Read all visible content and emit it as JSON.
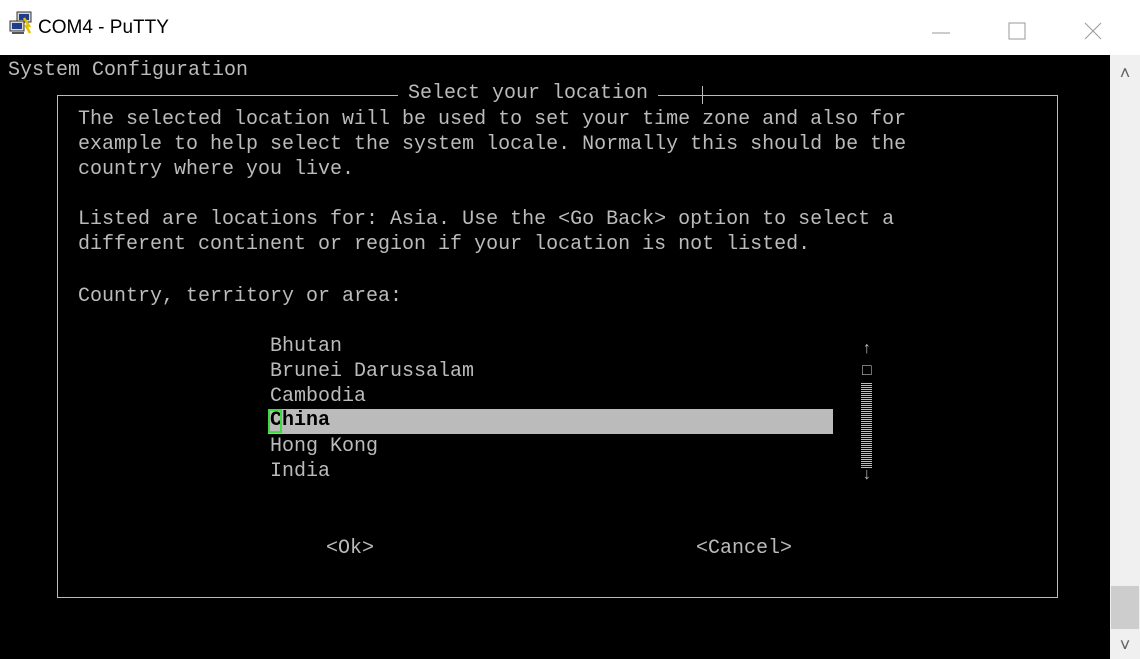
{
  "window": {
    "title": "COM4 - PuTTY",
    "icons": [
      "putty-icon",
      "minimize-icon",
      "maximize-icon",
      "close-icon"
    ]
  },
  "terminal": {
    "header": "System Configuration",
    "dialog": {
      "title": "Select your location",
      "description": [
        "The selected location will be used to set your time zone and also for",
        "example to help select the system locale. Normally this should be the",
        "country where you live."
      ],
      "info": [
        "Listed are locations for: Asia. Use the <Go Back> option to select a",
        "different continent or region if your location is not listed."
      ],
      "prompt": "Country, territory or area:",
      "items": [
        "Bhutan",
        "Brunei Darussalam",
        "Cambodia",
        "China",
        "Hong Kong",
        "India"
      ],
      "selected": "China",
      "scroll_up": "↑",
      "scroll_mark": "□",
      "scroll_down": "↓",
      "ok_label": "<Ok>",
      "cancel_label": "<Cancel>"
    }
  },
  "scrollbar": {
    "up": "˄",
    "down": "˅"
  },
  "colors": {
    "terminal_bg": "#000000",
    "terminal_fg": "#bbbbbb",
    "selection_bg": "#bbbbbb",
    "cursor": "#3cdc3c"
  }
}
